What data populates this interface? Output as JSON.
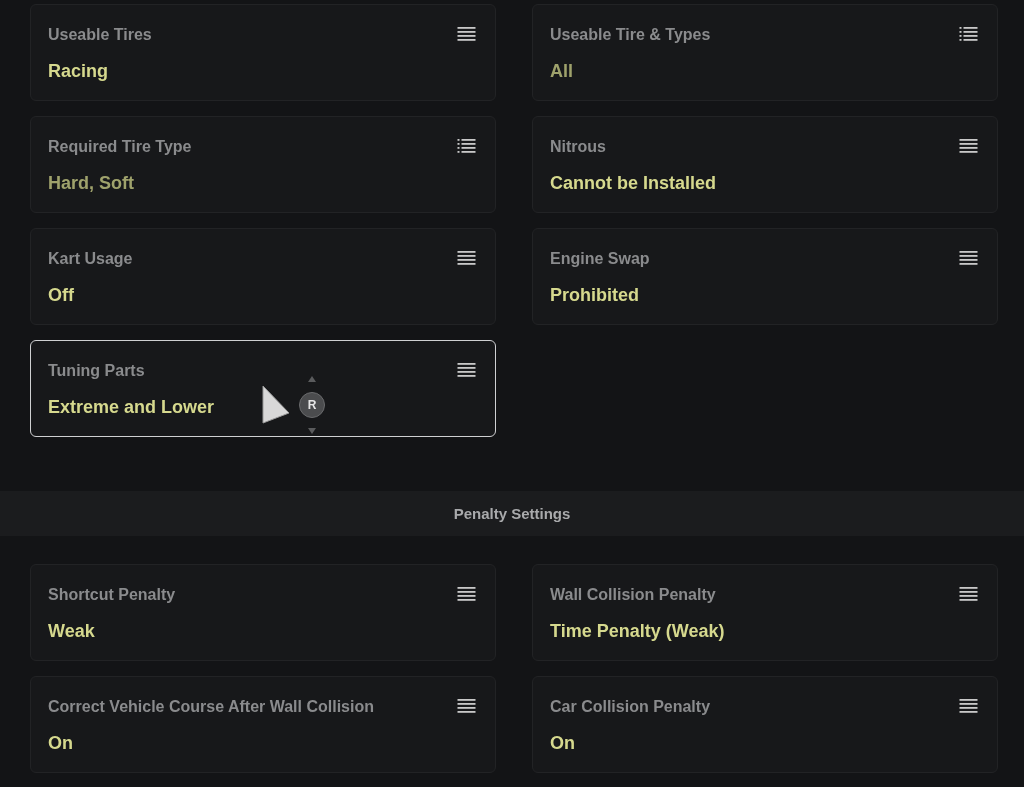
{
  "sections": [
    {
      "cards": [
        {
          "label": "Useable Tires",
          "value": "Racing",
          "kind": "single",
          "dimmed": false,
          "selected": false
        },
        {
          "label": "Useable Tire & Types",
          "value": "All",
          "kind": "multi",
          "dimmed": true,
          "selected": false
        },
        {
          "label": "Required Tire Type",
          "value": "Hard, Soft",
          "kind": "multi",
          "dimmed": true,
          "selected": false
        },
        {
          "label": "Nitrous",
          "value": "Cannot be Installed",
          "kind": "single",
          "dimmed": false,
          "selected": false
        },
        {
          "label": "Kart Usage",
          "value": "Off",
          "kind": "single",
          "dimmed": false,
          "selected": false
        },
        {
          "label": "Engine Swap",
          "value": "Prohibited",
          "kind": "single",
          "dimmed": false,
          "selected": false
        },
        {
          "label": "Tuning Parts",
          "value": "Extreme and Lower",
          "kind": "single",
          "dimmed": false,
          "selected": true,
          "cursor_button": "R"
        }
      ]
    },
    {
      "title": "Penalty Settings",
      "cards": [
        {
          "label": "Shortcut Penalty",
          "value": "Weak",
          "kind": "single",
          "dimmed": false,
          "selected": false
        },
        {
          "label": "Wall Collision Penalty",
          "value": "Time Penalty (Weak)",
          "kind": "single",
          "dimmed": false,
          "selected": false
        },
        {
          "label": "Correct Vehicle Course After Wall Collision",
          "value": "On",
          "kind": "single",
          "dimmed": false,
          "selected": false
        },
        {
          "label": "Car Collision Penalty",
          "value": "On",
          "kind": "single",
          "dimmed": false,
          "selected": false
        }
      ]
    }
  ]
}
